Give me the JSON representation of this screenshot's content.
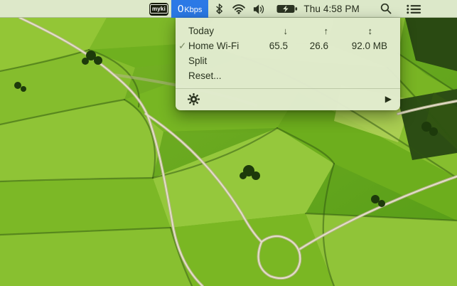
{
  "menu_bar": {
    "myki_badge": "myki",
    "bandwidth": {
      "value": "0",
      "unit": "Kbps"
    },
    "clock": "Thu 4:58 PM",
    "icons": [
      {
        "name": "bluetooth-icon"
      },
      {
        "name": "wifi-icon"
      },
      {
        "name": "volume-icon"
      },
      {
        "name": "battery-charging-icon"
      },
      {
        "name": "spotlight-search-icon"
      },
      {
        "name": "notification-center-icon"
      }
    ]
  },
  "dropdown": {
    "columns": {
      "period": "Today",
      "download": "↓",
      "upload": "↑",
      "total": "↕"
    },
    "interface": {
      "checkmark": "✓",
      "name": "Home Wi-Fi",
      "download": "65.5",
      "upload": "26.6",
      "total": "92.0 MB"
    },
    "menu_items": [
      {
        "label": "Split"
      },
      {
        "label": "Reset..."
      }
    ],
    "footer": {
      "settings_icon": "gear-icon",
      "expand_icon": "▶"
    }
  },
  "colors": {
    "accent_blue": "#2b79e6",
    "menubar_tint": "#e1ead0",
    "dropdown_tint": "#e2ebd0",
    "text_dark": "#2a3420",
    "field_green": "#7cb527",
    "path_tan": "#e6e2cb"
  }
}
